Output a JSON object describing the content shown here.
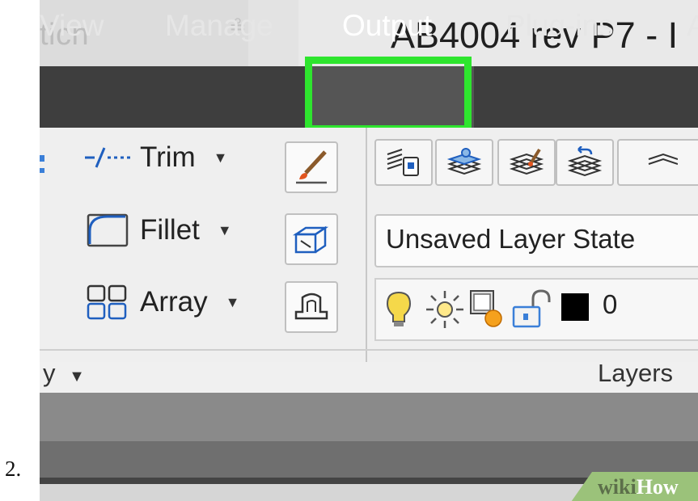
{
  "step_number": "2.",
  "title_bar": {
    "quick_access_search": "ticn",
    "title": "AB4004 rev P7 - I"
  },
  "tabs": [
    "View",
    "Manage",
    "Output",
    "Plug-ins",
    "A"
  ],
  "active_tab": "Output",
  "modify_panel": {
    "tools": [
      {
        "label": "Trim",
        "icon": "trim-icon"
      },
      {
        "label": "Fillet",
        "icon": "fillet-icon"
      },
      {
        "label": "Array",
        "icon": "array-icon"
      }
    ],
    "footer_label": "y"
  },
  "layers_panel": {
    "layer_state": "Unsaved Layer State",
    "current_layer": "0",
    "footer_label": "Layers"
  },
  "watermark": {
    "part1": "wiki",
    "part2": "How"
  },
  "colors": {
    "highlight": "#2ee52e",
    "tab_bar": "#3e3e3e"
  }
}
